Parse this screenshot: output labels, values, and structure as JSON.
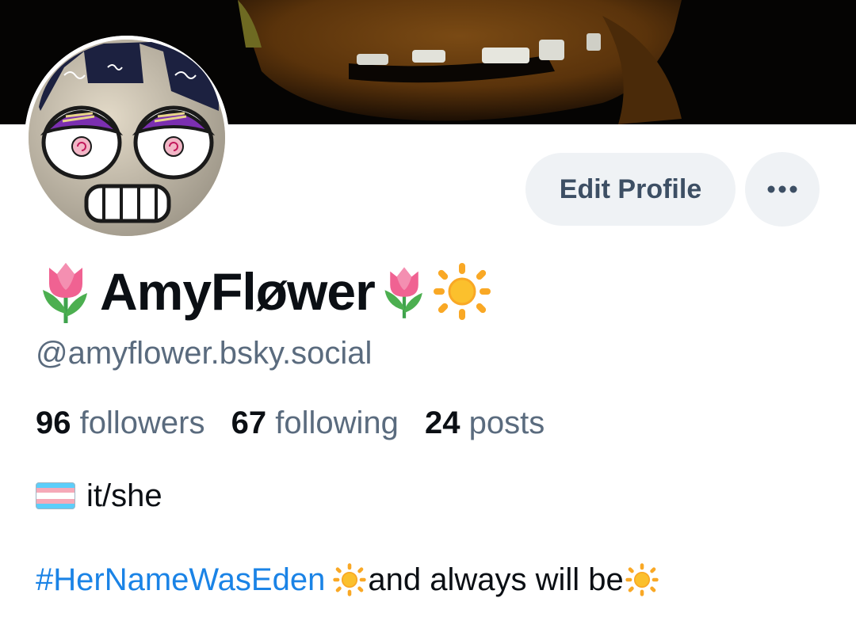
{
  "profile": {
    "display_name": "AmyFløwer",
    "handle": "@amyflower.bsky.social",
    "edit_label": "Edit Profile",
    "more_label": "•••",
    "stats": {
      "followers_count": "96",
      "followers_label": "followers",
      "following_count": "67",
      "following_label": "following",
      "posts_count": "24",
      "posts_label": "posts"
    },
    "bio": {
      "pronouns": "it/she",
      "hashtag": "#HerNameWasEden",
      "tagline": "and always will be"
    }
  },
  "icons": {
    "name_prefix": "tulip-icon",
    "name_suffix": [
      "tulip-icon",
      "sun-icon"
    ],
    "pronoun_flag": "transgender-flag-icon",
    "bio_decoration": "sun-icon"
  },
  "colors": {
    "link": "#1a83e6",
    "secondary_text": "#5a6b7e",
    "button_bg": "#eff2f5"
  }
}
